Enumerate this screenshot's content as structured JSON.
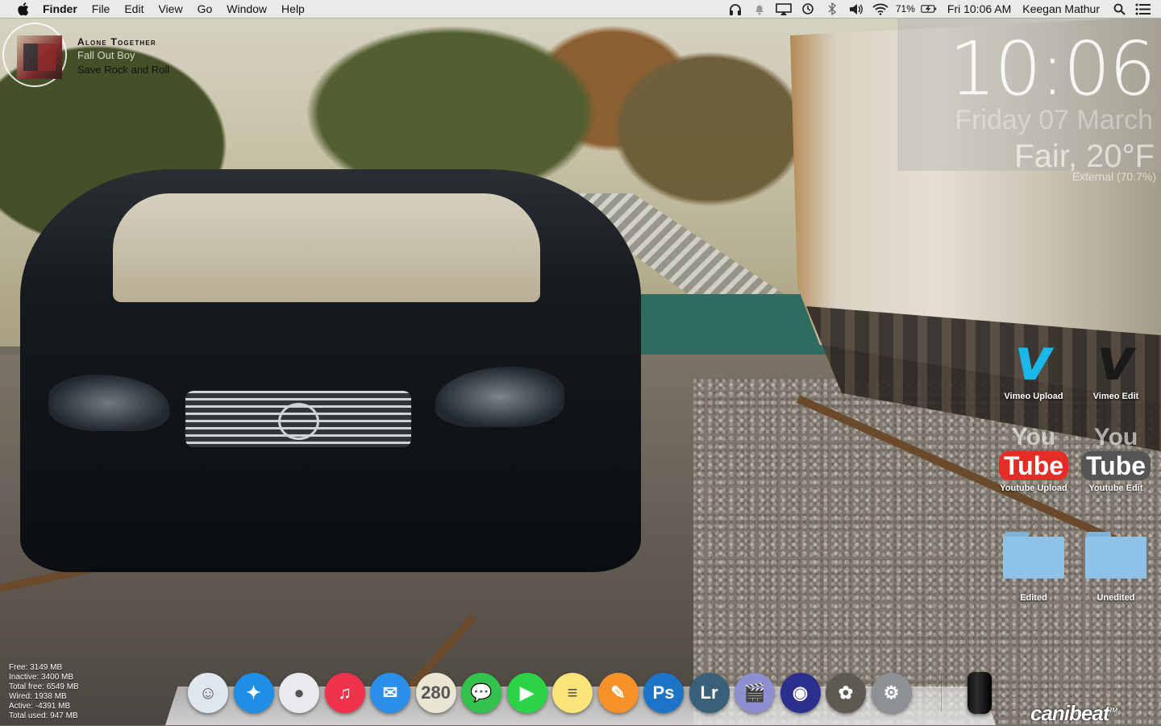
{
  "menubar": {
    "app_name": "Finder",
    "menus": [
      "File",
      "Edit",
      "View",
      "Go",
      "Window",
      "Help"
    ],
    "battery_percent": "71%",
    "datetime": "Fri 10:06 AM",
    "user": "Keegan Mathur",
    "icons": [
      "headphones-icon",
      "notification-icon",
      "airplay-icon",
      "time-machine-icon",
      "bluetooth-icon",
      "volume-icon",
      "wifi-icon",
      "battery-icon",
      "spotlight-icon",
      "notification-center-icon"
    ]
  },
  "now_playing": {
    "title": "Alone Together",
    "artist": "Fall Out Boy",
    "album": "Save Rock and Roll"
  },
  "clock": {
    "time": "10:06",
    "date": "Friday 07 March",
    "weather": "Fair, 20°F",
    "battery": "External (70.7%)"
  },
  "desktop_icons": [
    {
      "label": "Vimeo Upload",
      "icon": "vimeo-icon",
      "color": "#1ab7ea"
    },
    {
      "label": "Vimeo Edit",
      "icon": "vimeo-icon",
      "color": "#1a1a1a"
    },
    {
      "label": "Youtube Upload",
      "icon": "youtube-icon",
      "color": "#e52d27"
    },
    {
      "label": "Youtube Edit",
      "icon": "youtube-icon",
      "color": "#555555"
    },
    {
      "label": "Edited",
      "icon": "folder-icon",
      "color": "#8ec2e6"
    },
    {
      "label": "Unedited",
      "icon": "folder-icon",
      "color": "#8ec2e6"
    }
  ],
  "memory": [
    "Free: 3149 MB",
    "Inactive: 3400 MB",
    "Total free: 6549 MB",
    "Wired: 1938 MB",
    "Active: -4391 MB",
    "Total used: 947 MB"
  ],
  "dock": {
    "apps": [
      {
        "name": "finder-icon",
        "glyph": "☺",
        "color": "#dfe6ee"
      },
      {
        "name": "safari-icon",
        "glyph": "✦",
        "color": "#1f8fe6"
      },
      {
        "name": "chrome-icon",
        "glyph": "●",
        "color": "#e8eaed"
      },
      {
        "name": "itunes-icon",
        "glyph": "♫",
        "color": "#f0334d"
      },
      {
        "name": "mail-icon",
        "glyph": "✉",
        "color": "#2a8fe8"
      },
      {
        "name": "maps-icon",
        "glyph": "280",
        "color": "#e9e4d4"
      },
      {
        "name": "messages-icon",
        "glyph": "💬",
        "color": "#33c24d"
      },
      {
        "name": "facetime-icon",
        "glyph": "▶",
        "color": "#2bd447"
      },
      {
        "name": "notes-icon",
        "glyph": "≡",
        "color": "#fbe57a"
      },
      {
        "name": "pages-icon",
        "glyph": "✎",
        "color": "#f7922b"
      },
      {
        "name": "photoshop-icon",
        "glyph": "Ps",
        "color": "#1c73c7"
      },
      {
        "name": "lightroom-icon",
        "glyph": "Lr",
        "color": "#3a5f78"
      },
      {
        "name": "final-cut-icon",
        "glyph": "🎬",
        "color": "#8e8fd1"
      },
      {
        "name": "audio-app-icon",
        "glyph": "◉",
        "color": "#2d2f8f"
      },
      {
        "name": "gimp-icon",
        "glyph": "✿",
        "color": "#5e5a52"
      },
      {
        "name": "system-preferences-icon",
        "glyph": "⚙",
        "color": "#8d9196"
      }
    ],
    "trash": "trash-icon"
  },
  "logo": {
    "text": "canibeat",
    "mark": "TM"
  }
}
